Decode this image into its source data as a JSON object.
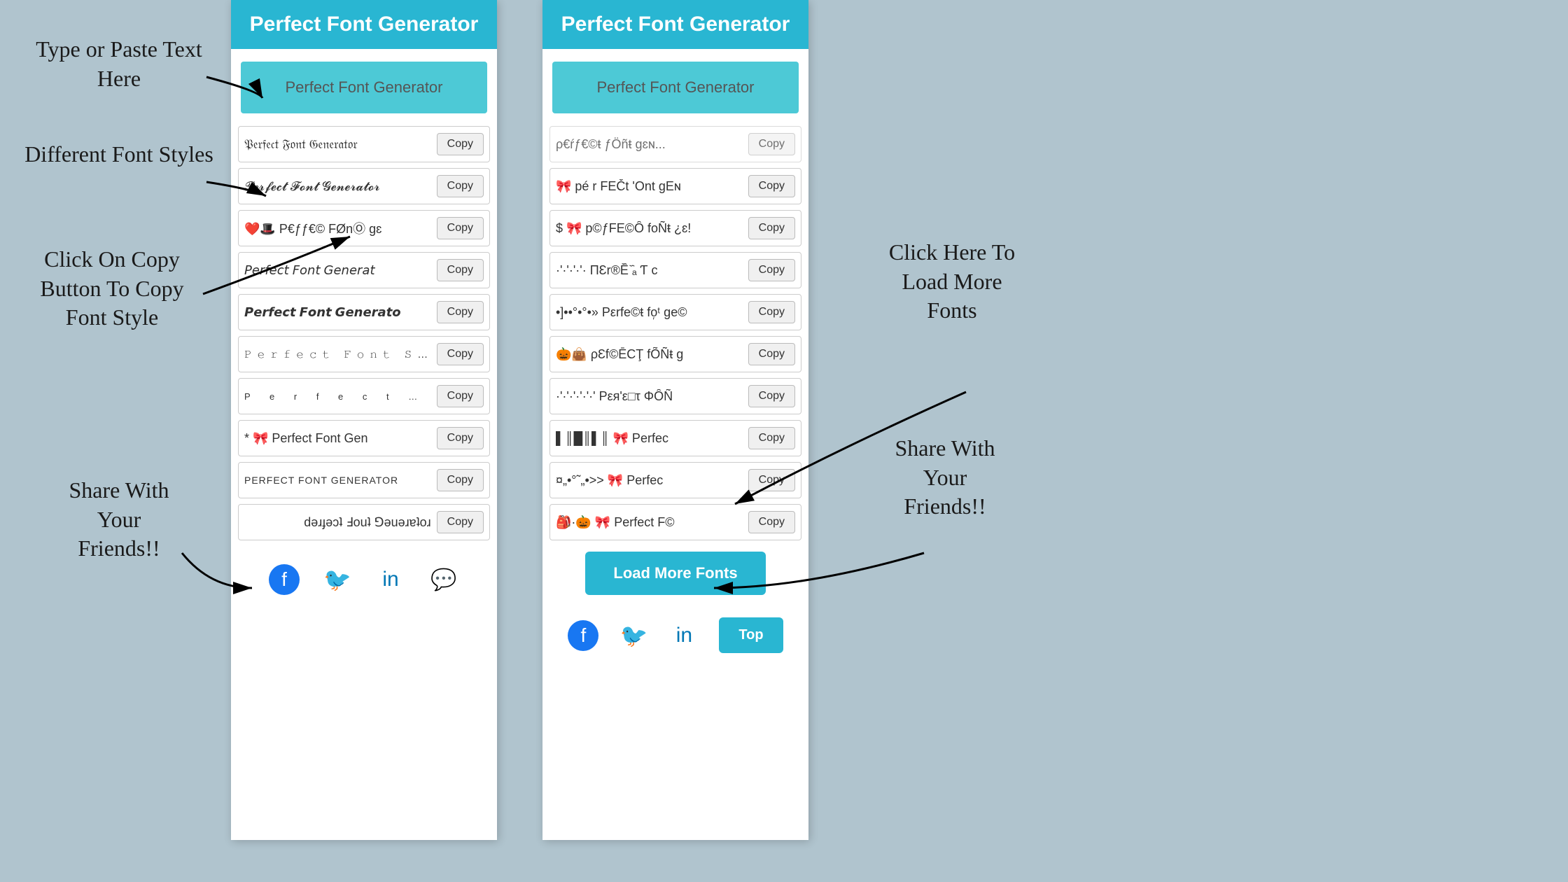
{
  "annotations": {
    "type_paste": "Type or Paste Text\nHere",
    "different_fonts": "Different Font\nStyles",
    "click_copy": "Click On Copy\nButton To Copy\nFont Style",
    "share_left": "Share With\nYour\nFriends!!",
    "click_load": "Click Here To\nLoad More\nFonts",
    "share_right": "Share With\nYour\nFriends!!"
  },
  "left_panel": {
    "header": "Perfect Font Generator",
    "input_placeholder": "Perfect Font Generator",
    "font_rows": [
      {
        "text": "𝔓𝔢𝔯𝔣𝔢𝔠𝔱 𝔉𝔬𝔫𝔱 𝔊𝔢𝔫𝔢𝔯𝔞𝔱𝔬𝔯",
        "copy": "Copy"
      },
      {
        "text": "𝓟𝓮𝓻𝓯𝓮𝓬𝓽 𝓕𝓸𝓷𝓽 𝓖𝓮𝓷𝓮𝓻𝓪𝓽𝓸𝓻",
        "copy": "Copy"
      },
      {
        "text": "❤️🎩 P€ƒƒ€© FØnⓄ gɛ",
        "copy": "Copy"
      },
      {
        "text": "𝘗𝘦𝘳𝘧𝘦𝘤𝘵 𝘍𝘰𝘯𝘵 𝘎𝘦𝘯𝘦𝘳𝘢𝘵",
        "copy": "Copy"
      },
      {
        "text": "𝙋𝙚𝙧𝙛𝙚𝙘𝙩 𝙁𝙤𝙣𝙩 𝙂𝙚𝙣𝙚𝙧𝙖𝙩𝙤",
        "copy": "Copy"
      },
      {
        "text": "𝙿𝚎𝚛𝚏𝚎𝚌𝚝 𝙵𝚘𝚗𝚝 𝙶𝚎𝚗𝚎𝚛𝚊𝚝𝚘𝚛",
        "copy": "Copy"
      },
      {
        "text": "P e r f e c t  F o n t",
        "copy": "Copy",
        "spaced": true
      },
      {
        "text": "* 🎀 Perfect Font Gen",
        "copy": "Copy"
      },
      {
        "text": "PERFECT FONT GENERATOR",
        "copy": "Copy",
        "upper": true
      },
      {
        "text": "ɹoʇɐɹǝuǝ⅁ ʇuoℲ ʇɔǝɟɹǝd",
        "copy": "Copy",
        "flip": true
      }
    ],
    "social": [
      "facebook",
      "twitter",
      "linkedin",
      "whatsapp"
    ]
  },
  "right_panel": {
    "header": "Perfect Font Generator",
    "input_placeholder": "Perfect Font Generator",
    "font_rows": [
      {
        "text": "ρ€ŕƒ€©ŧ ƒÖñŧ gɛɴ",
        "copy": "Copy",
        "partial": true
      },
      {
        "text": "$ 🎀 p©ƒFE©Ô foÑŧ ¿ɛ!",
        "copy": "Copy"
      },
      {
        "text": "·'·'·'·'· ΠƐr®Ē᷈ ᷈ₐ Ƭ c",
        "copy": "Copy"
      },
      {
        "text": "•]••°•°•»  Ρεrfe©ŧ fo᷊ᵗ ge©",
        "copy": "Copy"
      },
      {
        "text": "🎃👜 ρƐf©ĒCŢ fÕÑŧ g",
        "copy": "Copy"
      },
      {
        "text": "·'·'·'·'·'·' Ρεя'ε□τ ΦÔÑ",
        "copy": "Copy"
      },
      {
        "text": "▌║█║▌║ 🎀 Perfec",
        "copy": "Copy"
      },
      {
        "text": "¤„•°˜„•°˜•..>>  🎀  Perfec",
        "copy": "Copy"
      },
      {
        "text": "🎒 · 🎃 🎀 Perfect F©",
        "copy": "Copy"
      }
    ],
    "load_more": "Load More Fonts",
    "top_btn": "Top",
    "social": [
      "facebook",
      "twitter",
      "linkedin"
    ]
  }
}
